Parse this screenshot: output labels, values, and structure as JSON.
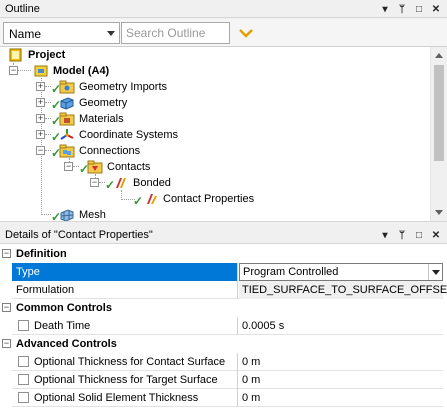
{
  "outline_panel": {
    "title": "Outline",
    "controls": {
      "dropdown": "▾",
      "pin": "ᛘ",
      "maximize": "□",
      "close": "✕"
    },
    "filter_select": {
      "value": "Name"
    },
    "search": {
      "placeholder": "Search Outline"
    }
  },
  "tree": {
    "items": [
      {
        "label": "Project",
        "icon": "project-icon",
        "bold": true
      },
      {
        "label": "Model (A4)",
        "icon": "model-icon",
        "bold": true
      },
      {
        "label": "Geometry Imports",
        "icon": "geometry-imports-icon"
      },
      {
        "label": "Geometry",
        "icon": "geometry-icon"
      },
      {
        "label": "Materials",
        "icon": "materials-icon"
      },
      {
        "label": "Coordinate Systems",
        "icon": "coordinate-systems-icon"
      },
      {
        "label": "Connections",
        "icon": "connections-icon"
      },
      {
        "label": "Contacts",
        "icon": "contacts-icon"
      },
      {
        "label": "Bonded",
        "icon": "bonded-contact-icon"
      },
      {
        "label": "Contact Properties",
        "icon": "contact-properties-icon"
      },
      {
        "label": "Mesh",
        "icon": "mesh-icon"
      }
    ],
    "status_color": "#2e9a2e"
  },
  "details_panel": {
    "title": "Details of \"Contact Properties\"",
    "sections": [
      {
        "title": "Definition",
        "rows": [
          {
            "key": "Type",
            "value": "Program Controlled",
            "selected": true
          },
          {
            "key": "Formulation",
            "value": "TIED_SURFACE_TO_SURFACE_OFFSET"
          }
        ]
      },
      {
        "title": "Common Controls",
        "rows": [
          {
            "key": "Death Time",
            "value": "0.0005 s"
          }
        ]
      },
      {
        "title": "Advanced Controls",
        "rows": [
          {
            "key": "Optional Thickness for Contact Surface",
            "value": "0 m"
          },
          {
            "key": "Optional Thickness for Target Surface",
            "value": "0 m"
          },
          {
            "key": "Optional Solid Element Thickness",
            "value": "0 m"
          }
        ]
      }
    ],
    "selection_color": "#0078d7"
  }
}
